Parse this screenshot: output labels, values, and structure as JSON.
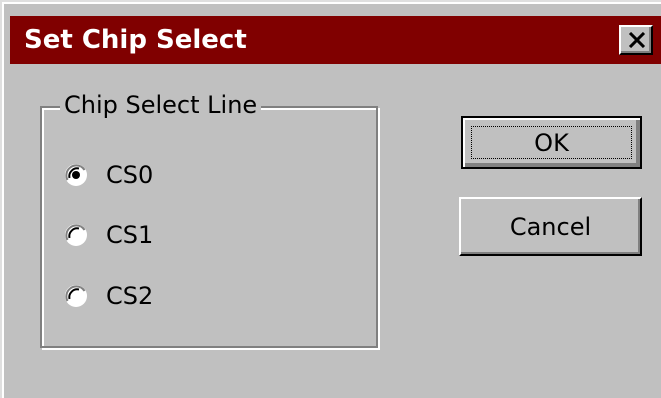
{
  "window": {
    "title": "Set Chip Select",
    "close_icon": "close-icon",
    "titlebar_color": "#800000",
    "face_color": "#c0c0c0"
  },
  "group": {
    "label": "Chip Select Line",
    "options": [
      {
        "label": "CS0",
        "selected": true
      },
      {
        "label": "CS1",
        "selected": false
      },
      {
        "label": "CS2",
        "selected": false
      }
    ]
  },
  "buttons": {
    "ok_label": "OK",
    "cancel_label": "Cancel"
  }
}
